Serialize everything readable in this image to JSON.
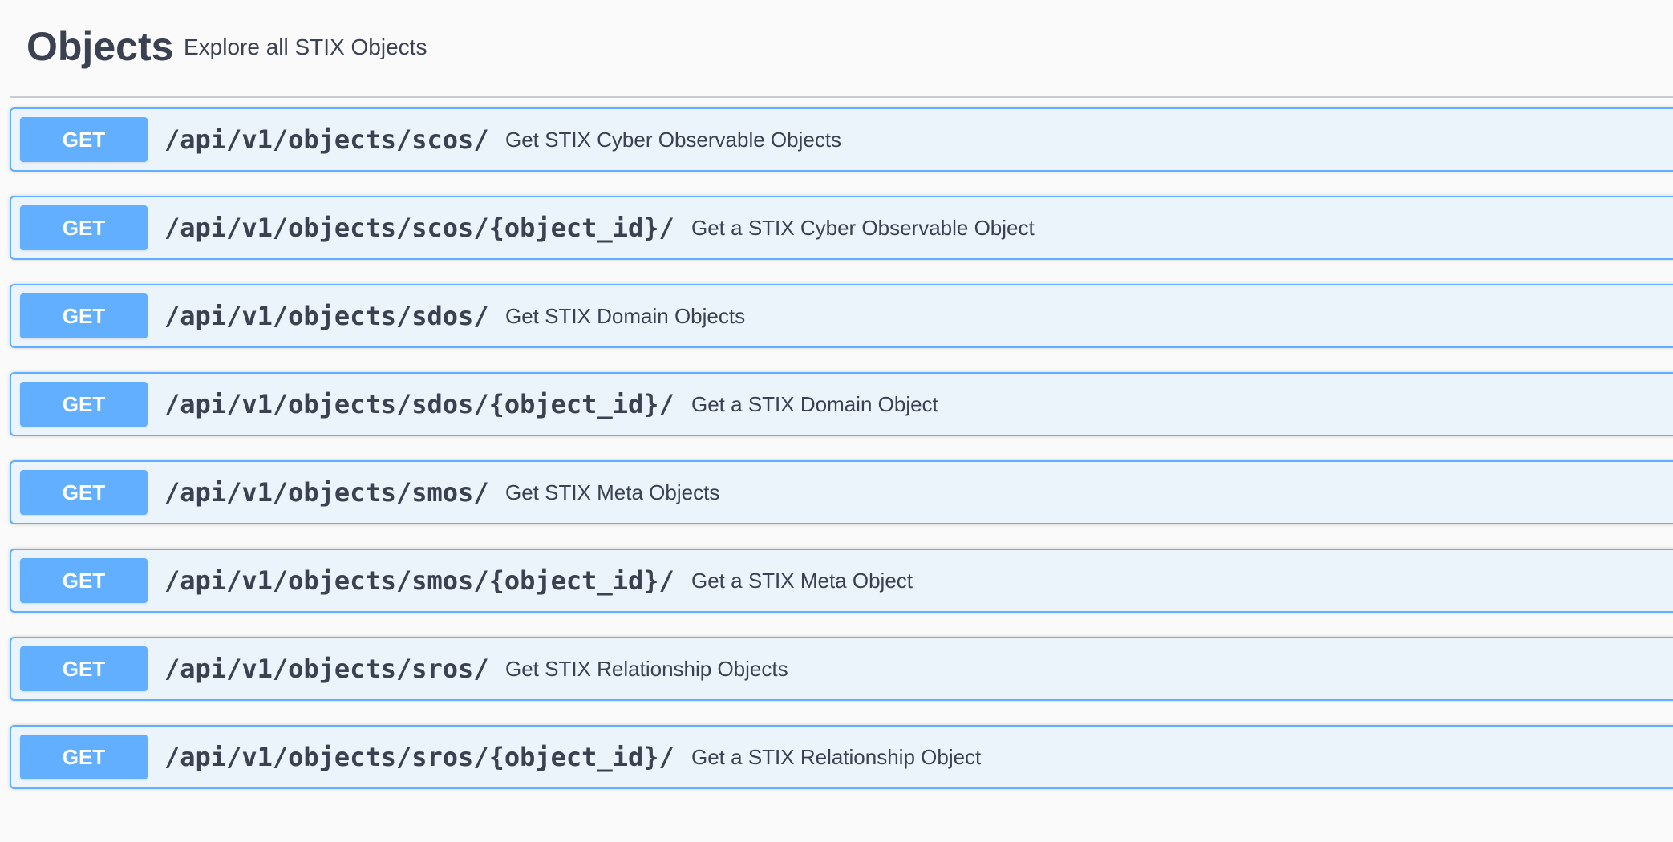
{
  "section": {
    "title": "Objects",
    "description": "Explore all STIX Objects"
  },
  "operations": [
    {
      "method": "GET",
      "path": "/api/v1/objects/scos/",
      "summary": "Get STIX Cyber Observable Objects"
    },
    {
      "method": "GET",
      "path": "/api/v1/objects/scos/{object_id}/",
      "summary": "Get a STIX Cyber Observable Object"
    },
    {
      "method": "GET",
      "path": "/api/v1/objects/sdos/",
      "summary": "Get STIX Domain Objects"
    },
    {
      "method": "GET",
      "path": "/api/v1/objects/sdos/{object_id}/",
      "summary": "Get a STIX Domain Object"
    },
    {
      "method": "GET",
      "path": "/api/v1/objects/smos/",
      "summary": "Get STIX Meta Objects"
    },
    {
      "method": "GET",
      "path": "/api/v1/objects/smos/{object_id}/",
      "summary": "Get a STIX Meta Object"
    },
    {
      "method": "GET",
      "path": "/api/v1/objects/sros/",
      "summary": "Get STIX Relationship Objects"
    },
    {
      "method": "GET",
      "path": "/api/v1/objects/sros/{object_id}/",
      "summary": "Get a STIX Relationship Object"
    }
  ],
  "colors": {
    "get_accent": "#61affe",
    "get_background": "#ebf3fb",
    "text": "#3b4151"
  }
}
